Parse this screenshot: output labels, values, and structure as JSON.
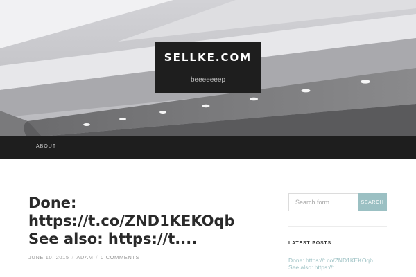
{
  "header": {
    "site_title": "SELLKE.COM",
    "site_description": "beeeeeeep"
  },
  "nav": {
    "items": [
      {
        "label": "ABOUT"
      }
    ]
  },
  "post": {
    "title_lines": [
      "Done:",
      "https://t.co/ZND1KEKOqb",
      "See also: https://t...."
    ],
    "date": "JUNE 10, 2015",
    "author": "ADAM",
    "comments": "0 COMMENTS",
    "meta_separator": "/"
  },
  "sidebar": {
    "search": {
      "placeholder": "Search form",
      "value": "",
      "button_label": "SEARCH"
    },
    "recent_posts": {
      "title": "LATEST POSTS",
      "items": [
        {
          "lines": [
            "Done: https://t.co/ZND1KEKOqb",
            "See also: https://t...."
          ]
        }
      ]
    }
  },
  "colors": {
    "dark_bar": "#1e1e1e",
    "accent": "#9bc0c3",
    "text": "#2a2a2a",
    "meta": "#9a9a9a"
  }
}
